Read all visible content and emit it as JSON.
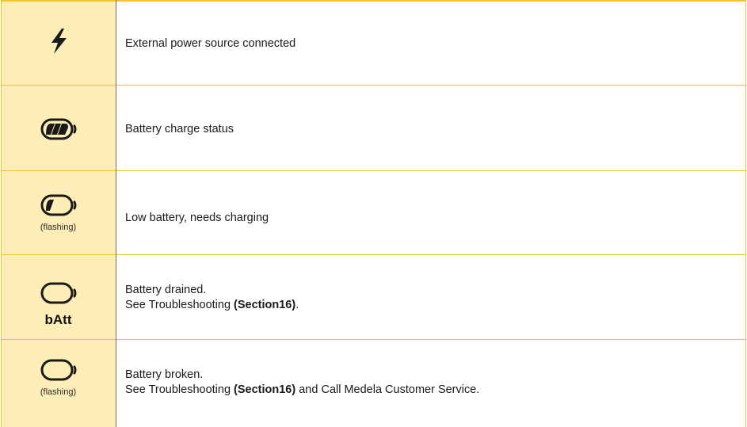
{
  "rows": [
    {
      "icon": "lightning-bolt-icon",
      "description": "External power source connected"
    },
    {
      "icon": "battery-charge-status-icon",
      "description": "Battery charge status"
    },
    {
      "icon": "battery-low-icon",
      "note": "(flashing)",
      "description": "Low battery, needs charging"
    },
    {
      "icon": "battery-empty-icon",
      "code": "bAtt",
      "line1": "Battery drained.",
      "line2_prefix": "See Troubleshooting ",
      "line2_bold": "(Section16)",
      "line2_suffix": "."
    },
    {
      "icon": "battery-empty-icon",
      "note": "(flashing)",
      "line1": "Battery broken.",
      "line2_prefix": "See Troubleshooting ",
      "line2_bold": "(Section16)",
      "line2_suffix": " and Call Medela Customer Service."
    }
  ],
  "colors": {
    "icon_column_bg": "#fdeeb8",
    "row_border": "#f2c230",
    "column_divider": "#6b6b6b",
    "icon": "#1a1a1a"
  }
}
